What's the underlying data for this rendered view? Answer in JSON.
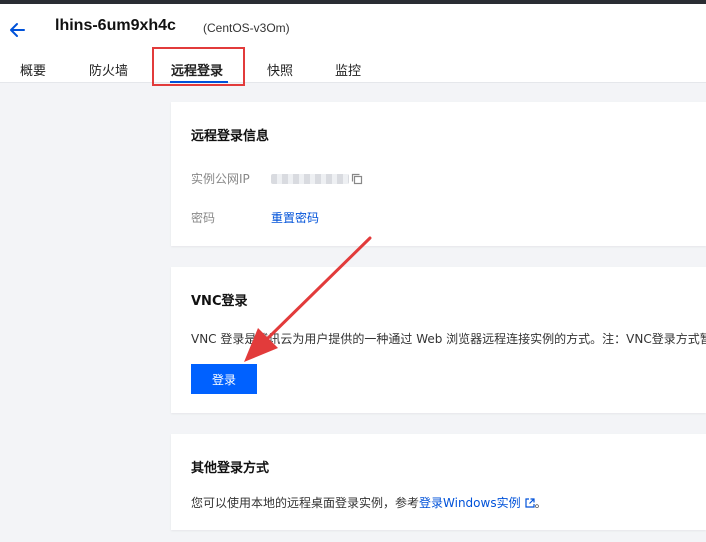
{
  "header": {
    "instance_name": "lhins-6um9xh4c",
    "os_label": "(CentOS-v3Om)"
  },
  "tabs": [
    {
      "label": "概要"
    },
    {
      "label": "防火墙"
    },
    {
      "label": "远程登录",
      "active": true
    },
    {
      "label": "快照"
    },
    {
      "label": "监控"
    }
  ],
  "remote_info": {
    "title": "远程登录信息",
    "ip_label": "实例公网IP",
    "password_label": "密码",
    "reset_password": "重置密码"
  },
  "vnc": {
    "title": "VNC登录",
    "description": "VNC 登录是腾讯云为用户提供的一种通过 Web 浏览器远程连接实例的方式。注：VNC登录方式暂",
    "login_button": "登录"
  },
  "other": {
    "title": "其他登录方式",
    "description_prefix": "您可以使用本地的远程桌面登录实例，参考",
    "link_text": "登录Windows实例",
    "description_suffix": "。"
  },
  "colors": {
    "primary": "#0061ff",
    "link": "#0052d9",
    "highlight": "#e23b3b"
  }
}
